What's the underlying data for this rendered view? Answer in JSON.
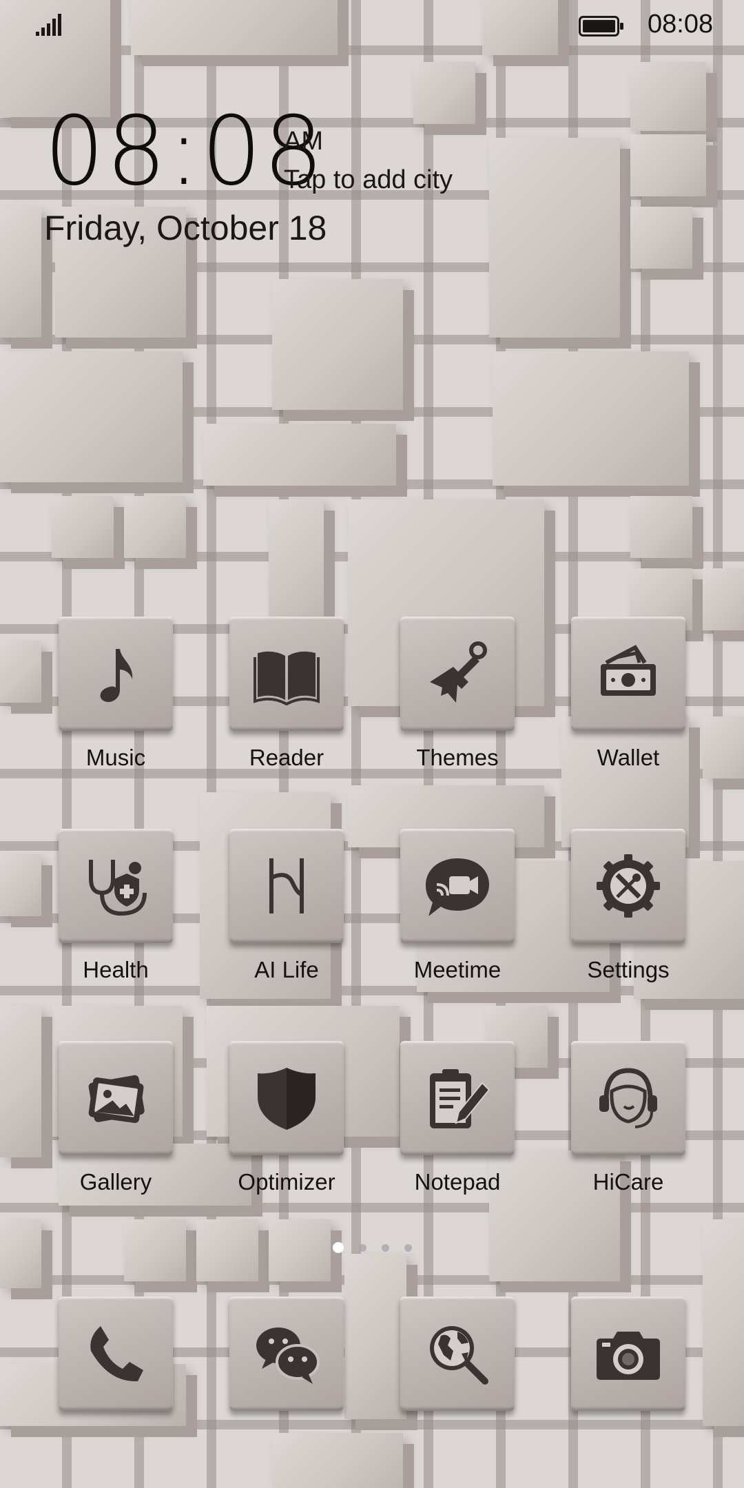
{
  "status_bar": {
    "time": "08:08",
    "signal_icon": "signal-icon",
    "battery_icon": "battery-icon"
  },
  "clock_widget": {
    "time": "08:08",
    "period": "AM",
    "city_prompt": "Tap to add city",
    "date": "Friday, October 18"
  },
  "apps": [
    {
      "label": "Music",
      "icon": "music-note-icon"
    },
    {
      "label": "Reader",
      "icon": "book-icon"
    },
    {
      "label": "Themes",
      "icon": "paintbrush-icon"
    },
    {
      "label": "Wallet",
      "icon": "wallet-icon"
    },
    {
      "label": "Health",
      "icon": "stethoscope-icon"
    },
    {
      "label": "AI Life",
      "icon": "ai-life-icon"
    },
    {
      "label": "Meetime",
      "icon": "video-chat-icon"
    },
    {
      "label": "Settings",
      "icon": "gear-icon"
    },
    {
      "label": "Gallery",
      "icon": "gallery-icon"
    },
    {
      "label": "Optimizer",
      "icon": "shield-icon"
    },
    {
      "label": "Notepad",
      "icon": "notepad-icon"
    },
    {
      "label": "HiCare",
      "icon": "headset-icon"
    }
  ],
  "dock": [
    {
      "icon": "phone-icon"
    },
    {
      "icon": "chat-icon"
    },
    {
      "icon": "browser-icon"
    },
    {
      "icon": "camera-icon"
    }
  ],
  "page_indicator": {
    "total": 4,
    "active": 1
  },
  "colors": {
    "icon": "#3a3332",
    "wallpaper": "#dcd7d4"
  }
}
